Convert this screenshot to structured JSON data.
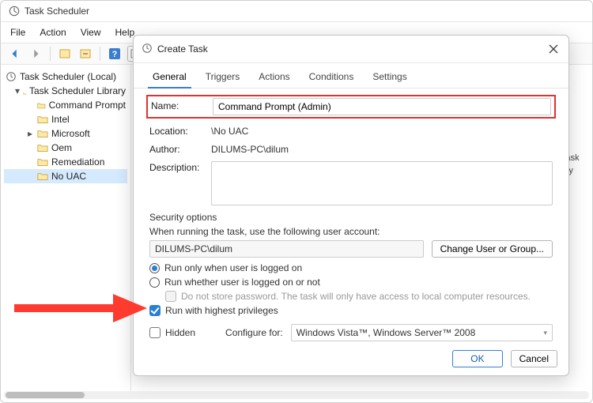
{
  "main_window": {
    "title": "Task Scheduler",
    "menus": [
      "File",
      "Action",
      "View",
      "Help"
    ],
    "tree": {
      "root": "Task Scheduler (Local)",
      "library": "Task Scheduler Library",
      "children": [
        "Command Prompt",
        "Intel",
        "Microsoft",
        "Oem",
        "Remediation",
        "No UAC"
      ]
    },
    "action_pane": {
      "line1": "g Task",
      "line2": "story"
    }
  },
  "dialog": {
    "title": "Create Task",
    "tabs": [
      "General",
      "Triggers",
      "Actions",
      "Conditions",
      "Settings"
    ],
    "labels": {
      "name": "Name:",
      "location": "Location:",
      "author": "Author:",
      "description": "Description:"
    },
    "values": {
      "name": "Command Prompt (Admin)",
      "location": "\\No UAC",
      "author": "DILUMS-PC\\dilum"
    },
    "security": {
      "heading": "Security options",
      "when_running": "When running the task, use the following user account:",
      "account": "DILUMS-PC\\dilum",
      "change_btn": "Change User or Group...",
      "radio_logged_on": "Run only when user is logged on",
      "radio_whether": "Run whether user is logged on or not",
      "do_not_store": "Do not store password.  The task will only have access to local computer resources.",
      "highest": "Run with highest privileges"
    },
    "bottom": {
      "hidden": "Hidden",
      "configure_for": "Configure for:",
      "configure_value": "Windows Vista™, Windows Server™ 2008"
    },
    "buttons": {
      "ok": "OK",
      "cancel": "Cancel"
    }
  }
}
